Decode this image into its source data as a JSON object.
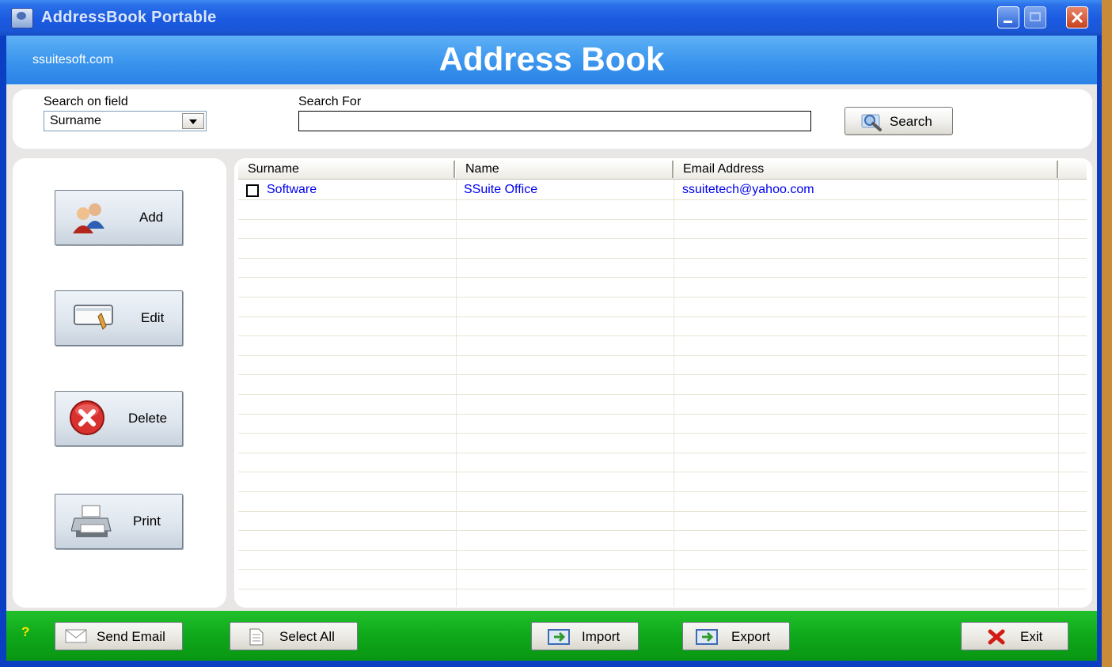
{
  "window": {
    "title": "AddressBook Portable",
    "controls": [
      "minimize-icon",
      "maximize-icon",
      "close-icon"
    ]
  },
  "banner": {
    "site": "ssuitesoft.com",
    "title": "Address Book"
  },
  "search": {
    "field_label": "Search on field",
    "field_value": "Surname",
    "for_label": "Search For",
    "for_value": "",
    "button_label": "Search"
  },
  "actions": {
    "add": "Add",
    "edit": "Edit",
    "delete": "Delete",
    "print": "Print"
  },
  "table": {
    "columns": [
      "Surname",
      "Name",
      "Email Address"
    ],
    "rows": [
      {
        "checked": false,
        "surname": "Software",
        "name": "SSuite Office",
        "email": "ssuitetech@yahoo.com"
      }
    ]
  },
  "footer": {
    "help": "?",
    "send_email": "Send Email",
    "select_all": "Select All",
    "import": "Import",
    "export": "Export",
    "exit": "Exit"
  },
  "colors": {
    "banner": "#3d97ee",
    "footer": "#0fa81b",
    "link_text": "#0000ee",
    "titlebar": "#1b5ae0"
  }
}
